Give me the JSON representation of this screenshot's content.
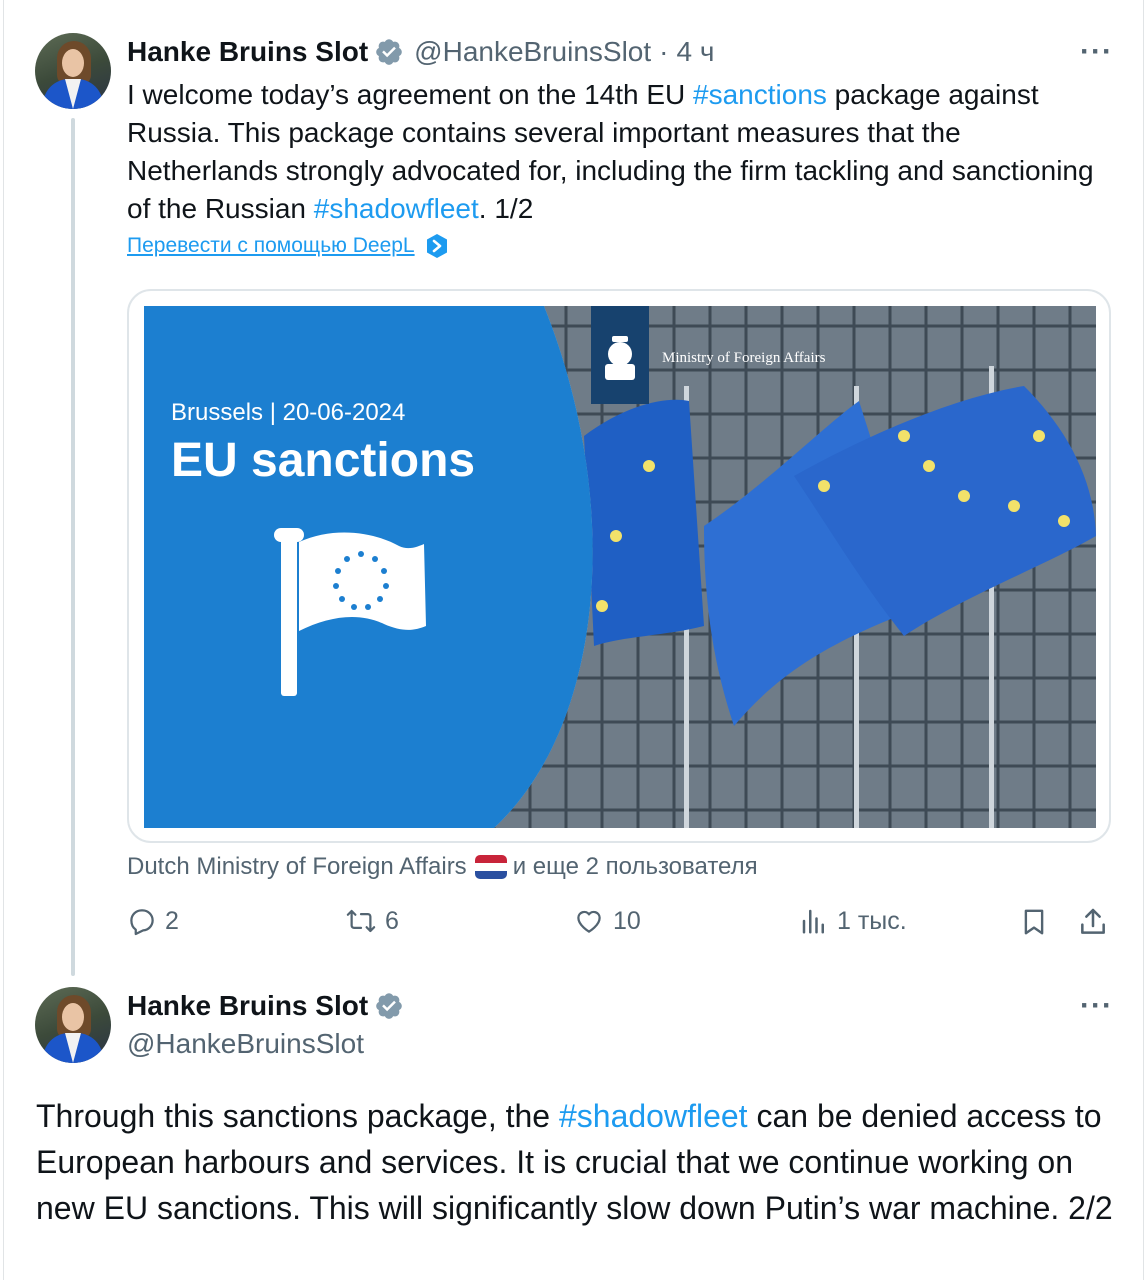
{
  "tweet1": {
    "author_name": "Hanke Bruins Slot",
    "handle": "@HankeBruinsSlot",
    "separator": "·",
    "time": "4 ч",
    "more_label": "···",
    "text_p1": "I welcome today’s agreement on the 14th EU ",
    "hashtag1": "#sanctions",
    "text_p2": " package against Russia. This package contains several important measures that the Netherlands strongly advocated for, including the firm tackling and sanctioning of the Russian ",
    "hashtag2": "#shadowfleet",
    "text_p3": ". 1/2",
    "translate_label": "Перевести с помощью DeepL",
    "image": {
      "location_date": "Brussels | 20-06-2024",
      "headline": "EU sanctions",
      "ministry": "Ministry of Foreign Affairs"
    },
    "tagged_account": "Dutch Ministry of Foreign Affairs",
    "tagged_more": "и еще 2 пользователя",
    "replies": "2",
    "reposts": "6",
    "likes": "10",
    "views": "1 тыс."
  },
  "tweet2": {
    "author_name": "Hanke Bruins Slot",
    "handle": "@HankeBruinsSlot",
    "more_label": "···",
    "text_p1": "Through this sanctions package, the ",
    "hashtag": "#shadowfleet",
    "text_p2": " can be denied access to European harbours and services. It is crucial that we continue working on new EU sanctions. This will significantly slow down Putin’s war machine. 2/2"
  },
  "colors": {
    "accent": "#1d9bf0",
    "text_secondary": "#536471",
    "image_blue": "#1c7fd0",
    "flag_blue": "#1f5fc4",
    "star_yellow": "#f2e26a"
  }
}
